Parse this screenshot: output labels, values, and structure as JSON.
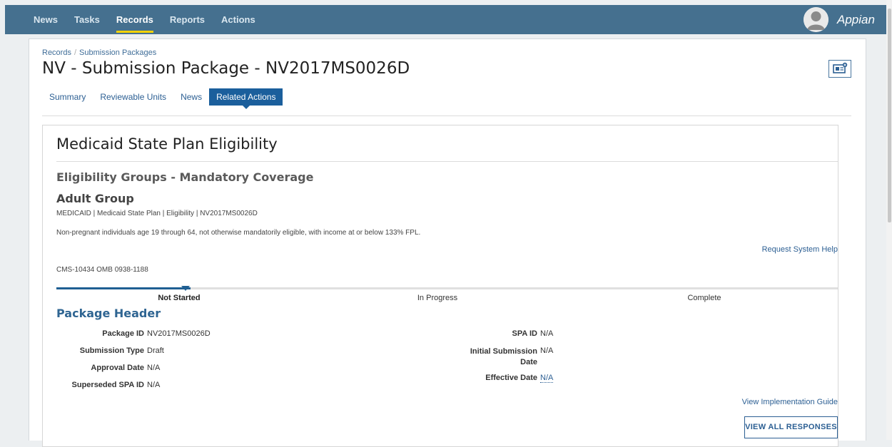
{
  "nav": {
    "items": [
      {
        "label": "News"
      },
      {
        "label": "Tasks"
      },
      {
        "label": "Records"
      },
      {
        "label": "Reports"
      },
      {
        "label": "Actions"
      }
    ],
    "active": "Records",
    "brand": "Appian"
  },
  "breadcrumb": {
    "root": "Records",
    "current": "Submission Packages"
  },
  "page": {
    "title": "NV - Submission Package - NV2017MS0026D"
  },
  "tabs": [
    {
      "label": "Summary"
    },
    {
      "label": "Reviewable Units"
    },
    {
      "label": "News"
    },
    {
      "label": "Related Actions"
    }
  ],
  "content": {
    "title": "Medicaid State Plan Eligibility",
    "section": "Eligibility Groups - Mandatory Coverage",
    "subsection": "Adult Group",
    "meta": "MEDICAID | Medicaid State Plan | Eligibility | NV2017MS0026D",
    "description": "Non-pregnant individuals age 19 through 64, not otherwise mandatorily eligible, with income at or below 133% FPL.",
    "help_link": "Request System Help",
    "omb": "CMS-10434 OMB 0938-1188"
  },
  "progress": {
    "steps": [
      "Not Started",
      "In Progress",
      "Complete"
    ],
    "current": "Not Started"
  },
  "package_header": {
    "title": "Package Header",
    "left": [
      {
        "label": "Package ID",
        "value": "NV2017MS0026D"
      },
      {
        "label": "Submission Type",
        "value": "Draft"
      },
      {
        "label": "Approval Date",
        "value": "N/A"
      },
      {
        "label": "Superseded SPA ID",
        "value": "N/A"
      }
    ],
    "right": [
      {
        "label": "SPA ID",
        "value": "N/A"
      },
      {
        "label": "Initial Submission",
        "label2": "Date",
        "value": "N/A"
      },
      {
        "label": "Effective Date",
        "value": "N/A"
      }
    ]
  },
  "links": {
    "guide": "View Implementation Guide",
    "view_all": "VIEW ALL RESPONSES"
  },
  "colors": {
    "topbar": "#45708f",
    "accent": "#f3d200",
    "link": "#2c5f93",
    "tab_active": "#1b5f9c"
  }
}
